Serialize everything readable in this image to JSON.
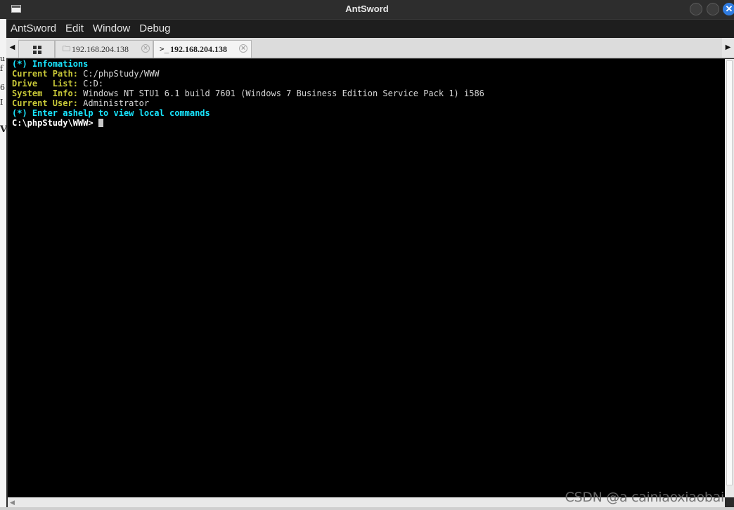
{
  "window": {
    "title": "AntSword"
  },
  "menu": [
    "AntSword",
    "Edit",
    "Window",
    "Debug"
  ],
  "tabs": [
    {
      "label": "192.168.204.138",
      "icon": "folder-icon",
      "active": false
    },
    {
      "label": "192.168.204.138",
      "icon": "terminal-icon",
      "active": true
    }
  ],
  "terminal": {
    "header": "(*) Infomations",
    "info": [
      {
        "key": "Current Path",
        "value": " C:/phpStudy/WWW"
      },
      {
        "key": "Drive   List",
        "value": " C:D:"
      },
      {
        "key": "System  Info",
        "value": " Windows NT STU1 6.1 build 7601 (Windows 7 Business Edition Service Pack 1) i586"
      },
      {
        "key": "Current User",
        "value": " Administrator"
      }
    ],
    "hint": "(*) Enter ashelp to view local commands",
    "prompt": "C:\\phpStudy\\WWW>"
  },
  "watermark": "CSDN @a cainiaoxiaobai",
  "colors": {
    "terminal_bg": "#000000",
    "cyan": "#18e6ff",
    "gold": "#c8c838",
    "close_button": "#2f7be0"
  }
}
